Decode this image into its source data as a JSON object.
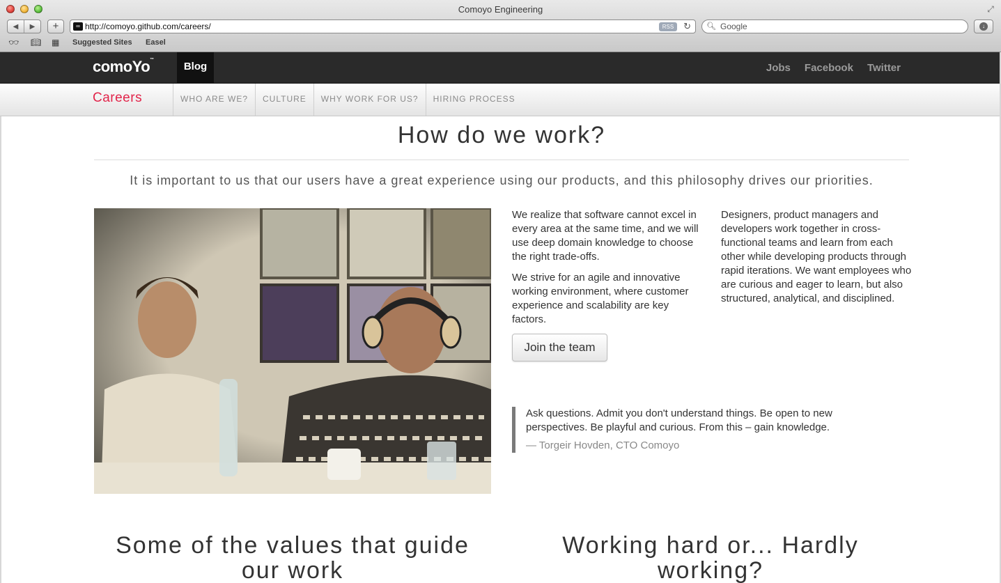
{
  "browser": {
    "window_title": "Comoyo Engineering",
    "url": "http://comoyo.github.com/careers/",
    "rss_label": "RSS",
    "search_placeholder": "Google",
    "bookmarks": [
      "Suggested Sites",
      "Easel"
    ]
  },
  "site": {
    "logo": "comoYo",
    "logo_tm": "™",
    "active_nav": "Blog",
    "right_links": [
      "Jobs",
      "Facebook",
      "Twitter"
    ],
    "section_title": "Careers",
    "subnav": [
      "WHO ARE WE?",
      "CULTURE",
      "WHY WORK FOR US?",
      "HIRING PROCESS"
    ]
  },
  "main": {
    "heading": "How do we work?",
    "lead": "It is important to us that our users have a great experience using our products, and this philosophy drives our priorities.",
    "col_a": [
      "We realize that software cannot excel in every area at the same time, and we will use deep domain knowledge to choose the right trade-offs.",
      "We strive for an agile and innovative working environment, where customer experience and scalability are key factors."
    ],
    "col_b": "Designers, product managers and developers work together in cross-functional teams and learn from each other while developing products through rapid iterations. We want employees who are curious and eager to learn, but also structured, analytical, and disciplined.",
    "join_button": "Join the team",
    "quote": {
      "text": "Ask questions. Admit you don't understand things. Be open to new perspectives. Be playful and curious. From this – gain knowledge.",
      "cite": "— Torgeir Hovden, CTO Comoyo"
    },
    "bottom_left_heading": "Some of the values that guide our work",
    "bottom_right_heading": "Working hard or... Hardly working?"
  }
}
